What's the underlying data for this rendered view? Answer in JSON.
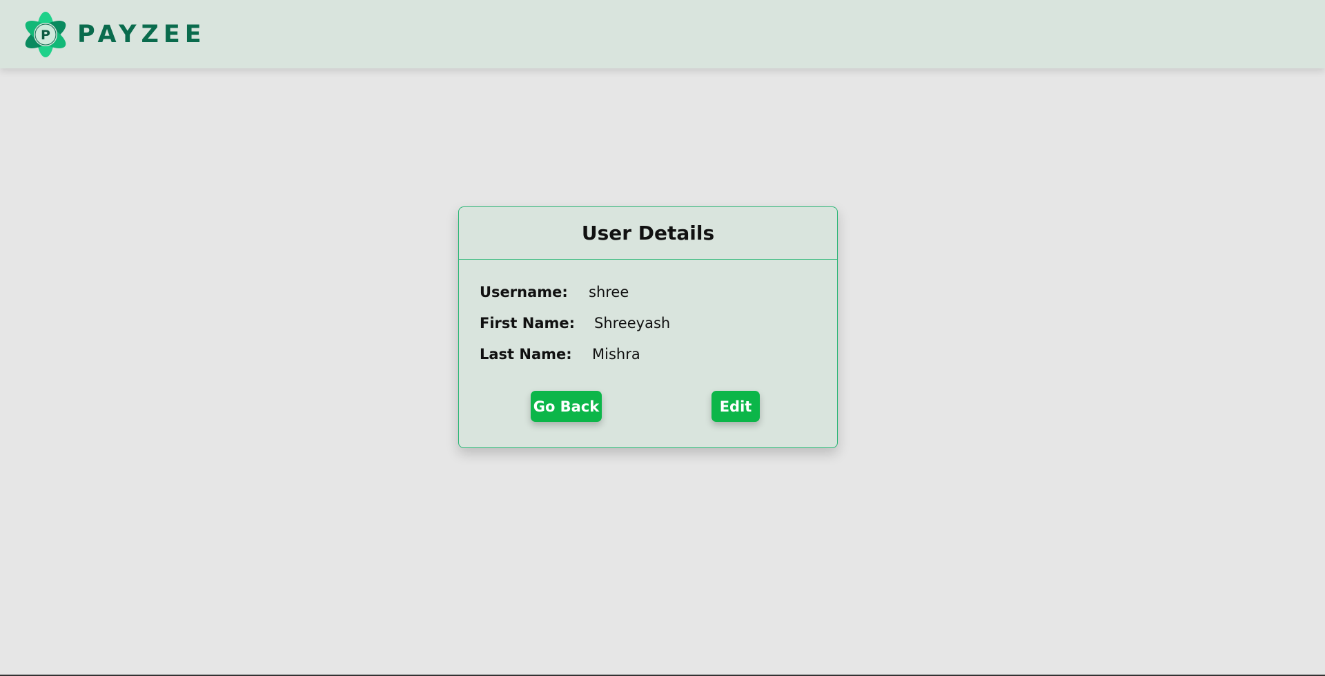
{
  "brand": {
    "name": "PAYZEE",
    "logo_letter": "P",
    "colors": {
      "dark": "#0a6b4d",
      "light": "#1fd18a",
      "accent": "#0cb649"
    }
  },
  "card": {
    "title": "User Details",
    "fields": [
      {
        "label": "Username:",
        "value": "shree"
      },
      {
        "label": "First Name:",
        "value": "Shreeyash"
      },
      {
        "label": "Last Name:",
        "value": "Mishra"
      }
    ],
    "go_back_label": "Go Back",
    "edit_label": "Edit"
  }
}
